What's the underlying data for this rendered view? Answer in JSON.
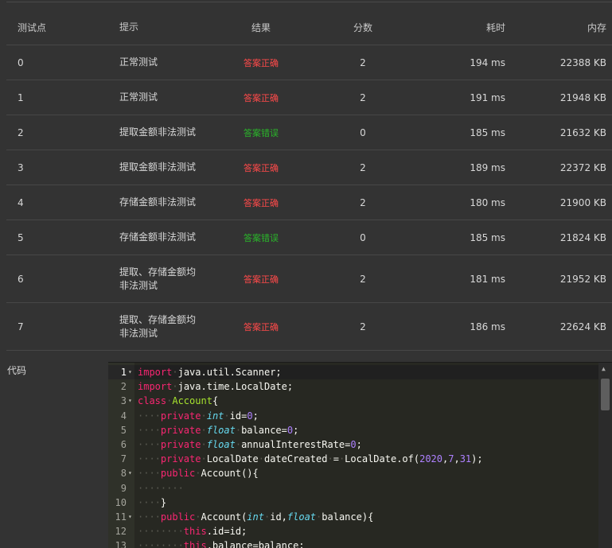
{
  "table": {
    "headers": {
      "id": "测试点",
      "hint": "提示",
      "result": "结果",
      "score": "分数",
      "time": "耗时",
      "memory": "内存"
    },
    "rows": [
      {
        "id": "0",
        "hint1": "正常测试",
        "hint2": "",
        "result": "答案正确",
        "status": "ok",
        "score": "2",
        "time": "194 ms",
        "memory": "22388 KB"
      },
      {
        "id": "1",
        "hint1": "正常测试",
        "hint2": "",
        "result": "答案正确",
        "status": "ok",
        "score": "2",
        "time": "191 ms",
        "memory": "21948 KB"
      },
      {
        "id": "2",
        "hint1": "提取金额非法测试",
        "hint2": "",
        "result": "答案错误",
        "status": "wrong",
        "score": "0",
        "time": "185 ms",
        "memory": "21632 KB"
      },
      {
        "id": "3",
        "hint1": "提取金额非法测试",
        "hint2": "",
        "result": "答案正确",
        "status": "ok",
        "score": "2",
        "time": "189 ms",
        "memory": "22372 KB"
      },
      {
        "id": "4",
        "hint1": "存储金额非法测试",
        "hint2": "",
        "result": "答案正确",
        "status": "ok",
        "score": "2",
        "time": "180 ms",
        "memory": "21900 KB"
      },
      {
        "id": "5",
        "hint1": "存储金额非法测试",
        "hint2": "",
        "result": "答案错误",
        "status": "wrong",
        "score": "0",
        "time": "185 ms",
        "memory": "21824 KB"
      },
      {
        "id": "6",
        "hint1": "提取、存储金额均",
        "hint2": "非法测试",
        "result": "答案正确",
        "status": "ok",
        "score": "2",
        "time": "181 ms",
        "memory": "21952 KB"
      },
      {
        "id": "7",
        "hint1": "提取、存储金额均",
        "hint2": "非法测试",
        "result": "答案正确",
        "status": "ok",
        "score": "2",
        "time": "186 ms",
        "memory": "22624 KB"
      }
    ]
  },
  "code_section": {
    "label": "代码",
    "lines": [
      {
        "n": "1",
        "fold": true,
        "text": "import java.util.Scanner;"
      },
      {
        "n": "2",
        "fold": false,
        "text": "import java.time.LocalDate;"
      },
      {
        "n": "3",
        "fold": true,
        "text": "class Account{"
      },
      {
        "n": "4",
        "fold": false,
        "text": "    private int id=0;"
      },
      {
        "n": "5",
        "fold": false,
        "text": "    private float balance=0;"
      },
      {
        "n": "6",
        "fold": false,
        "text": "    private float annualInterestRate=0;"
      },
      {
        "n": "7",
        "fold": false,
        "text": "    private LocalDate dateCreated = LocalDate.of(2020,7,31);"
      },
      {
        "n": "8",
        "fold": true,
        "text": "    public Account(){"
      },
      {
        "n": "9",
        "fold": false,
        "text": "        "
      },
      {
        "n": "10",
        "fold": false,
        "text": "    }"
      },
      {
        "n": "11",
        "fold": true,
        "text": "    public Account(int id,float balance){"
      },
      {
        "n": "12",
        "fold": false,
        "text": "        this.id=id;"
      },
      {
        "n": "13",
        "fold": false,
        "text": "        this.balance=balance;"
      }
    ]
  },
  "colors": {
    "result_ok": "#ff4a4a",
    "result_wrong": "#2ab52a",
    "keyword": "#f92672",
    "type": "#66d9ef",
    "class_name": "#a6e22e",
    "number": "#ae81ff"
  },
  "icons": {
    "fold": "fold-arrow-icon",
    "scroll_up": "scroll-up-arrow-icon"
  }
}
